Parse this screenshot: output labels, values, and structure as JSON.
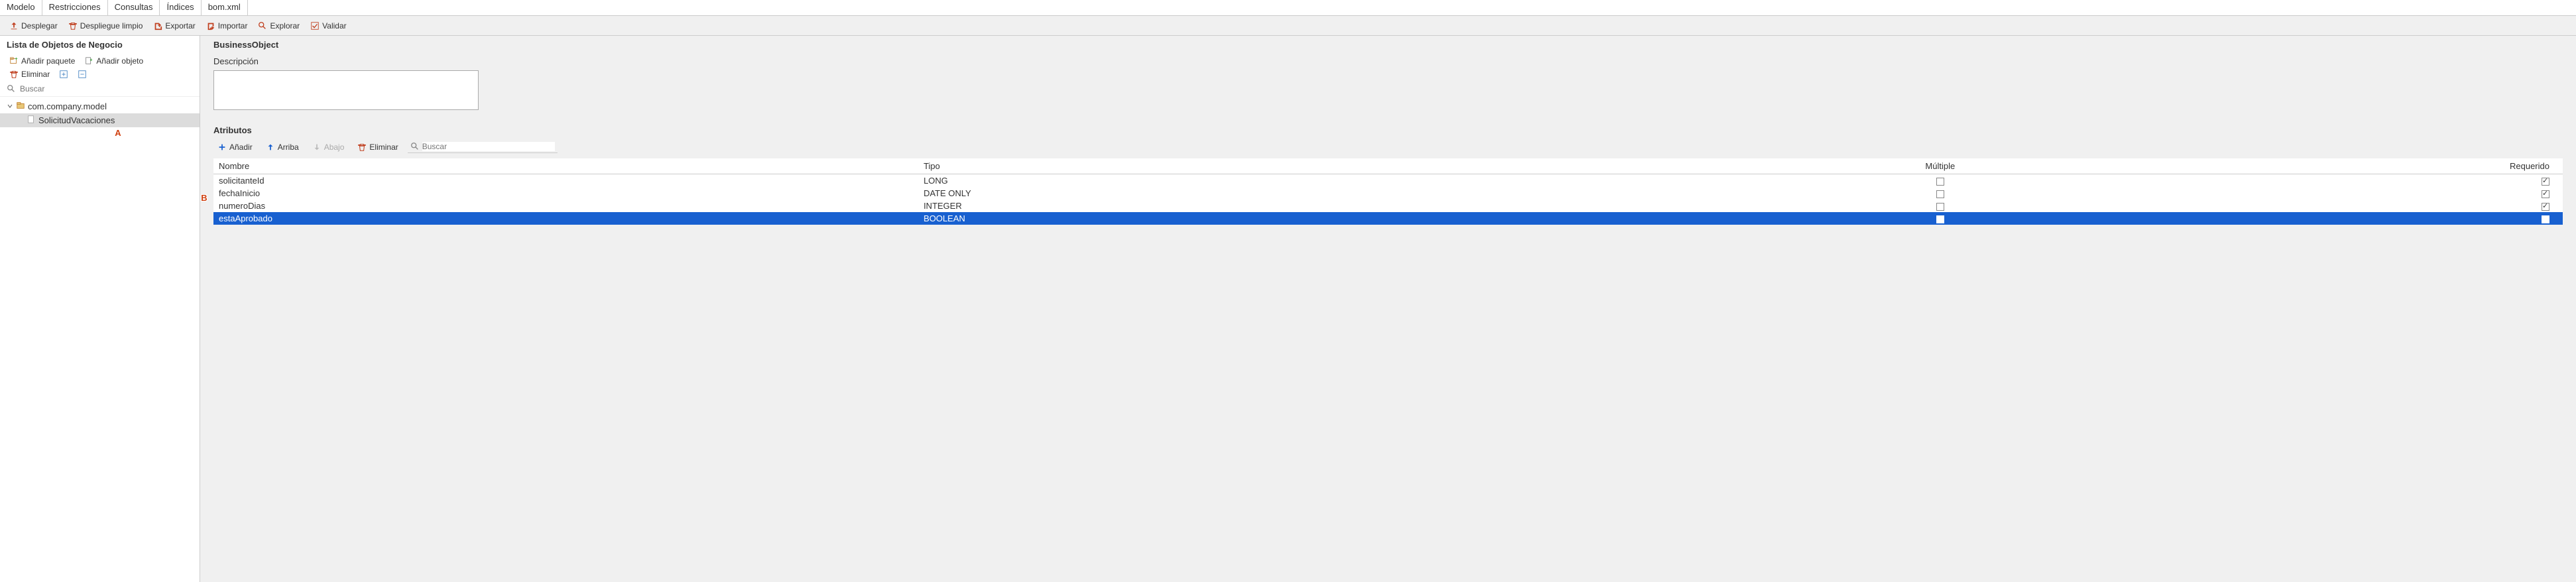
{
  "tabs": {
    "items": [
      {
        "label": "Modelo",
        "active": true
      },
      {
        "label": "Restricciones",
        "active": false
      },
      {
        "label": "Consultas",
        "active": false
      },
      {
        "label": "Índices",
        "active": false
      },
      {
        "label": "bom.xml",
        "active": false
      }
    ]
  },
  "toolbar": {
    "deploy": "Desplegar",
    "clean_deploy": "Despliegue limpio",
    "export": "Exportar",
    "import": "Importar",
    "explore": "Explorar",
    "validate": "Validar"
  },
  "left": {
    "title": "Lista de Objetos de Negocio",
    "add_package": "Añadir paquete",
    "add_object": "Añadir objeto",
    "delete": "Eliminar",
    "search_placeholder": "Buscar",
    "tree": {
      "package": "com.company.model",
      "object": "SolicitudVacaciones"
    }
  },
  "right": {
    "header": "BusinessObject",
    "desc_label": "Descripción",
    "desc_value": "",
    "attributes_label": "Atributos",
    "attr_toolbar": {
      "add": "Añadir",
      "up": "Arriba",
      "down": "Abajo",
      "delete": "Eliminar",
      "search_placeholder": "Buscar"
    },
    "columns": {
      "name": "Nombre",
      "type": "Tipo",
      "multiple": "Múltiple",
      "required": "Requerido"
    },
    "rows": [
      {
        "name": "solicitanteId",
        "type": "LONG",
        "multiple": false,
        "required": true,
        "selected": false
      },
      {
        "name": "fechaInicio",
        "type": "DATE ONLY",
        "multiple": false,
        "required": true,
        "selected": false
      },
      {
        "name": "numeroDias",
        "type": "INTEGER",
        "multiple": false,
        "required": true,
        "selected": false
      },
      {
        "name": "estaAprobado",
        "type": "BOOLEAN",
        "multiple": false,
        "required": false,
        "selected": true
      }
    ]
  },
  "callouts": {
    "a": "A",
    "b": "B"
  }
}
